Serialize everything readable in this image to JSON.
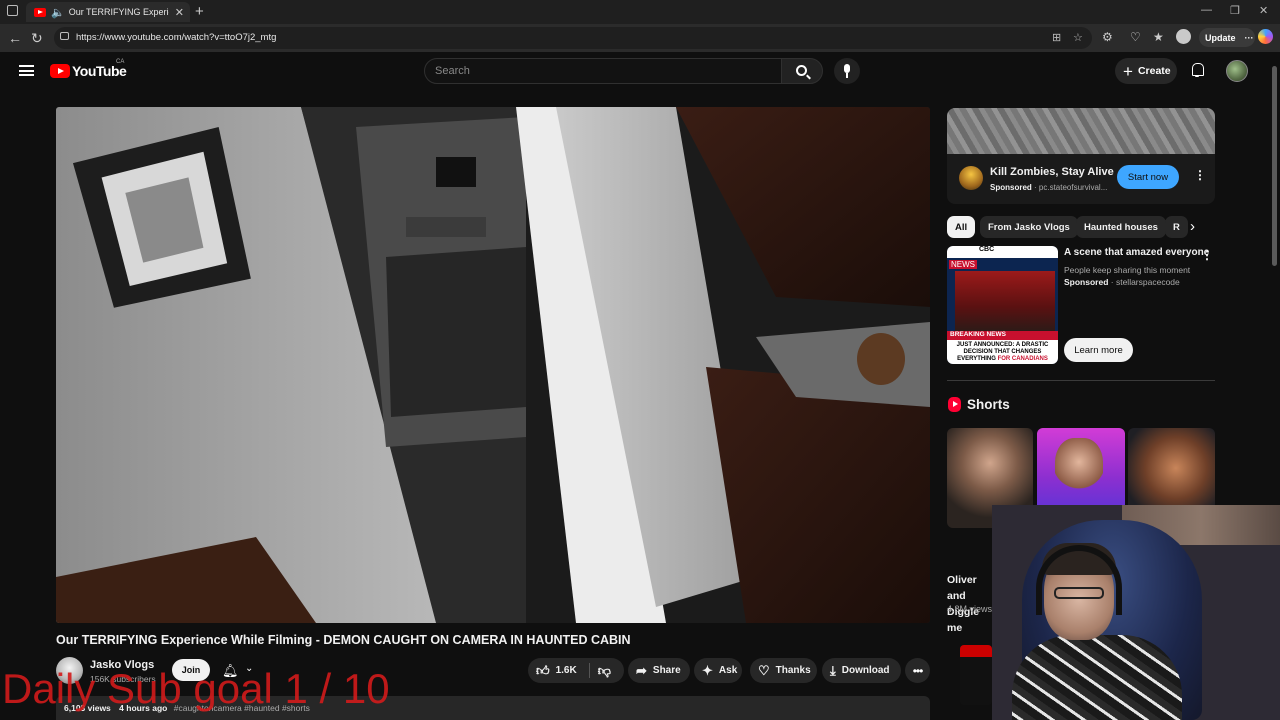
{
  "browser": {
    "tab_title": "Our TERRIFYING Experience",
    "url": "https://www.youtube.com/watch?v=ttoO7j2_mtg",
    "update_label": "Update"
  },
  "youtube": {
    "logo_text": "YouTube",
    "country_code": "CA",
    "search_placeholder": "Search",
    "create_label": "Create"
  },
  "video": {
    "title": "Our TERRIFYING Experience While Filming - DEMON CAUGHT ON CAMERA IN HAUNTED CABIN",
    "channel_name": "Jasko Vlogs",
    "subscribers": "156K subscribers",
    "join_label": "Join",
    "likes": "1.6K",
    "share_label": "Share",
    "ask_label": "Ask",
    "thanks_label": "Thanks",
    "download_label": "Download",
    "views": "6,103 views",
    "age": "4 hours ago",
    "tags": "#caughtoncamera #haunted #shorts"
  },
  "overlay": {
    "goal_text": "Daily Sub goal 1 / 10"
  },
  "sidebar": {
    "ad1": {
      "title": "Kill Zombies, Stay Alive",
      "sponsored": "Sponsored",
      "domain": "pc.stateofsurvival...",
      "cta": "Start now"
    },
    "chips": [
      "All",
      "From Jasko Vlogs",
      "Haunted houses",
      "R"
    ],
    "ad2": {
      "title": "A scene that amazed everyone",
      "desc": "People keep sharing this moment",
      "sponsored": "Sponsored",
      "domain": "stellarspacecode",
      "cta": "Learn more",
      "thumb_brand": "CBC",
      "thumb_news": "NEWS",
      "thumb_breaking": "BREAKING NEWS",
      "thumb_headline": "JUST ANNOUNCED: A DRASTIC DECISION THAT CHANGES EVERYTHING",
      "thumb_headline_red": "FOR CANADIANS"
    },
    "shorts": {
      "heading": "Shorts",
      "first_title": "Oliver and Diggle me",
      "first_views": "4.8M views"
    }
  },
  "colors": {
    "yt_red": "#ff0000",
    "link_blue": "#3ea6ff",
    "overlay_red": "#d21b1b"
  }
}
